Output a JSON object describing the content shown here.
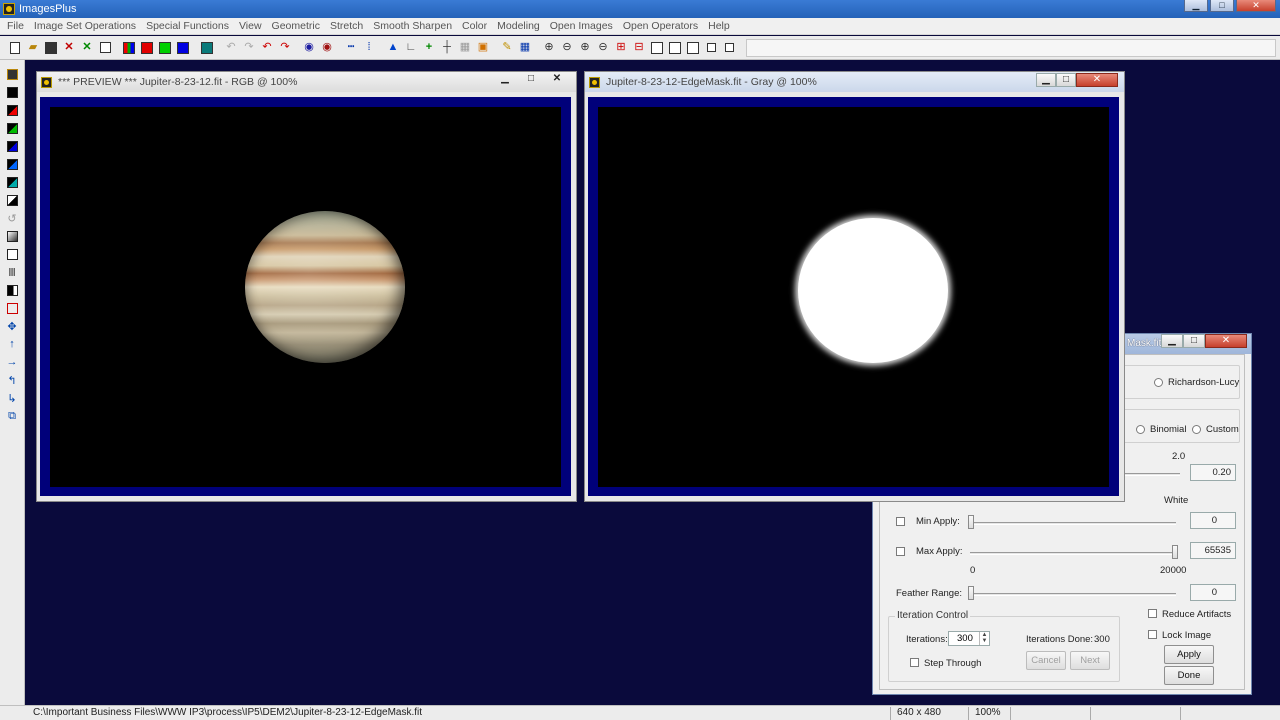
{
  "app": {
    "title": "ImagesPlus"
  },
  "menu": [
    "File",
    "Image Set Operations",
    "Special Functions",
    "View",
    "Geometric",
    "Stretch",
    "Smooth Sharpen",
    "Color",
    "Modeling",
    "Open Images",
    "Open Operators",
    "Help"
  ],
  "windows": {
    "preview": {
      "title": "*** PREVIEW *** Jupiter-8-23-12.fit - RGB @ 100%"
    },
    "mask": {
      "title": "Jupiter-8-23-12-EdgeMask.fit - Gray @ 100%"
    }
  },
  "dialog": {
    "title_fragment": "Mask.fit",
    "method": {
      "option_richardson_lucy": "Richardson-Lucy"
    },
    "psf": {
      "option_binomial": "Binomial",
      "option_custom": "Custom"
    },
    "range_label": "2.0",
    "param_value": "0.20",
    "white_label": "White",
    "min_apply": {
      "label": "Min Apply:",
      "value": "0"
    },
    "max_apply": {
      "label": "Max Apply:",
      "value": "65535"
    },
    "feather": {
      "range_min": "0",
      "range_max": "20000",
      "label": "Feather Range:",
      "value": "0"
    },
    "iteration": {
      "group_label": "Iteration Control",
      "iterations_label": "Iterations:",
      "iterations_value": "300",
      "done_label": "Iterations Done:",
      "done_value": "300",
      "step_through": "Step Through",
      "cancel": "Cancel",
      "next": "Next"
    },
    "reduce_artifacts": "Reduce Artifacts",
    "lock_image": "Lock Image",
    "apply": "Apply",
    "done": "Done"
  },
  "status": {
    "path": "C:\\Important Business Files\\WWW IP3\\process\\IP5\\DEM2\\Jupiter-8-23-12-EdgeMask.fit",
    "dimensions": "640 x 480",
    "zoom": "100%"
  },
  "colors": {
    "desktop": "#0a0a3c",
    "viewport_border": "#00007a",
    "titlebar": "#2462b8"
  }
}
